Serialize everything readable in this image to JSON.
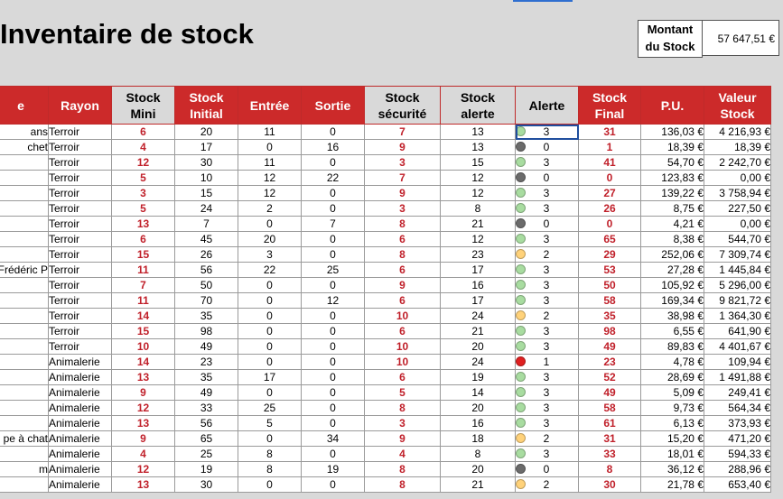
{
  "title": "Inventaire de stock",
  "summary": {
    "label_line1": "Montant",
    "label_line2": "du Stock",
    "value": "57 647,51 €"
  },
  "headers": [
    {
      "l1": "e",
      "l2": ""
    },
    {
      "l1": "Rayon",
      "l2": ""
    },
    {
      "l1": "Stock",
      "l2": "Mini"
    },
    {
      "l1": "Stock",
      "l2": "Initial"
    },
    {
      "l1": "Entrée",
      "l2": ""
    },
    {
      "l1": "Sortie",
      "l2": ""
    },
    {
      "l1": "Stock",
      "l2": "sécurité"
    },
    {
      "l1": "Stock",
      "l2": "alerte"
    },
    {
      "l1": "Alerte",
      "l2": ""
    },
    {
      "l1": "Stock",
      "l2": "Final"
    },
    {
      "l1": "P.U.",
      "l2": ""
    },
    {
      "l1": "Valeur",
      "l2": "Stock"
    }
  ],
  "alert_colors": {
    "green": "#a8dca0",
    "gray": "#6b6b6b",
    "orange": "#ffd27a",
    "red": "#e02020"
  },
  "rows": [
    {
      "name": "ans",
      "rayon": "Terroir",
      "mini": "6",
      "initial": "20",
      "entree": "11",
      "sortie": "0",
      "securite": "7",
      "alerte": "13",
      "flag": "green",
      "flag_val": "3",
      "final": "31",
      "pu": "136,03 €",
      "valeur": "4 216,93 €"
    },
    {
      "name": "chet",
      "rayon": "Terroir",
      "mini": "4",
      "initial": "17",
      "entree": "0",
      "sortie": "16",
      "securite": "9",
      "alerte": "13",
      "flag": "gray",
      "flag_val": "0",
      "final": "1",
      "pu": "18,39 €",
      "valeur": "18,39 €"
    },
    {
      "name": "",
      "rayon": "Terroir",
      "mini": "12",
      "initial": "30",
      "entree": "11",
      "sortie": "0",
      "securite": "3",
      "alerte": "15",
      "flag": "green",
      "flag_val": "3",
      "final": "41",
      "pu": "54,70 €",
      "valeur": "2 242,70 €"
    },
    {
      "name": "",
      "rayon": "Terroir",
      "mini": "5",
      "initial": "10",
      "entree": "12",
      "sortie": "22",
      "securite": "7",
      "alerte": "12",
      "flag": "gray",
      "flag_val": "0",
      "final": "0",
      "pu": "123,83 €",
      "valeur": "0,00 €"
    },
    {
      "name": "",
      "rayon": "Terroir",
      "mini": "3",
      "initial": "15",
      "entree": "12",
      "sortie": "0",
      "securite": "9",
      "alerte": "12",
      "flag": "green",
      "flag_val": "3",
      "final": "27",
      "pu": "139,22 €",
      "valeur": "3 758,94 €"
    },
    {
      "name": "",
      "rayon": "Terroir",
      "mini": "5",
      "initial": "24",
      "entree": "2",
      "sortie": "0",
      "securite": "3",
      "alerte": "8",
      "flag": "green",
      "flag_val": "3",
      "final": "26",
      "pu": "8,75 €",
      "valeur": "227,50 €"
    },
    {
      "name": "",
      "rayon": "Terroir",
      "mini": "13",
      "initial": "7",
      "entree": "0",
      "sortie": "7",
      "securite": "8",
      "alerte": "21",
      "flag": "gray",
      "flag_val": "0",
      "final": "0",
      "pu": "4,21 €",
      "valeur": "0,00 €"
    },
    {
      "name": "",
      "rayon": "Terroir",
      "mini": "6",
      "initial": "45",
      "entree": "20",
      "sortie": "0",
      "securite": "6",
      "alerte": "12",
      "flag": "green",
      "flag_val": "3",
      "final": "65",
      "pu": "8,38 €",
      "valeur": "544,70 €"
    },
    {
      "name": "",
      "rayon": "Terroir",
      "mini": "15",
      "initial": "26",
      "entree": "3",
      "sortie": "0",
      "securite": "8",
      "alerte": "23",
      "flag": "orange",
      "flag_val": "2",
      "final": "29",
      "pu": "252,06 €",
      "valeur": "7 309,74 €"
    },
    {
      "name": "Frédéric P",
      "rayon": "Terroir",
      "mini": "11",
      "initial": "56",
      "entree": "22",
      "sortie": "25",
      "securite": "6",
      "alerte": "17",
      "flag": "green",
      "flag_val": "3",
      "final": "53",
      "pu": "27,28 €",
      "valeur": "1 445,84 €"
    },
    {
      "name": "",
      "rayon": "Terroir",
      "mini": "7",
      "initial": "50",
      "entree": "0",
      "sortie": "0",
      "securite": "9",
      "alerte": "16",
      "flag": "green",
      "flag_val": "3",
      "final": "50",
      "pu": "105,92 €",
      "valeur": "5 296,00 €"
    },
    {
      "name": "",
      "rayon": "Terroir",
      "mini": "11",
      "initial": "70",
      "entree": "0",
      "sortie": "12",
      "securite": "6",
      "alerte": "17",
      "flag": "green",
      "flag_val": "3",
      "final": "58",
      "pu": "169,34 €",
      "valeur": "9 821,72 €"
    },
    {
      "name": "",
      "rayon": "Terroir",
      "mini": "14",
      "initial": "35",
      "entree": "0",
      "sortie": "0",
      "securite": "10",
      "alerte": "24",
      "flag": "orange",
      "flag_val": "2",
      "final": "35",
      "pu": "38,98 €",
      "valeur": "1 364,30 €"
    },
    {
      "name": "",
      "rayon": "Terroir",
      "mini": "15",
      "initial": "98",
      "entree": "0",
      "sortie": "0",
      "securite": "6",
      "alerte": "21",
      "flag": "green",
      "flag_val": "3",
      "final": "98",
      "pu": "6,55 €",
      "valeur": "641,90 €"
    },
    {
      "name": "",
      "rayon": "Terroir",
      "mini": "10",
      "initial": "49",
      "entree": "0",
      "sortie": "0",
      "securite": "10",
      "alerte": "20",
      "flag": "green",
      "flag_val": "3",
      "final": "49",
      "pu": "89,83 €",
      "valeur": "4 401,67 €"
    },
    {
      "name": "",
      "rayon": "Animalerie",
      "mini": "14",
      "initial": "23",
      "entree": "0",
      "sortie": "0",
      "securite": "10",
      "alerte": "24",
      "flag": "red",
      "flag_val": "1",
      "final": "23",
      "pu": "4,78 €",
      "valeur": "109,94 €"
    },
    {
      "name": "",
      "rayon": "Animalerie",
      "mini": "13",
      "initial": "35",
      "entree": "17",
      "sortie": "0",
      "securite": "6",
      "alerte": "19",
      "flag": "green",
      "flag_val": "3",
      "final": "52",
      "pu": "28,69 €",
      "valeur": "1 491,88 €"
    },
    {
      "name": "",
      "rayon": "Animalerie",
      "mini": "9",
      "initial": "49",
      "entree": "0",
      "sortie": "0",
      "securite": "5",
      "alerte": "14",
      "flag": "green",
      "flag_val": "3",
      "final": "49",
      "pu": "5,09 €",
      "valeur": "249,41 €"
    },
    {
      "name": "",
      "rayon": "Animalerie",
      "mini": "12",
      "initial": "33",
      "entree": "25",
      "sortie": "0",
      "securite": "8",
      "alerte": "20",
      "flag": "green",
      "flag_val": "3",
      "final": "58",
      "pu": "9,73 €",
      "valeur": "564,34 €"
    },
    {
      "name": "",
      "rayon": "Animalerie",
      "mini": "13",
      "initial": "56",
      "entree": "5",
      "sortie": "0",
      "securite": "3",
      "alerte": "16",
      "flag": "green",
      "flag_val": "3",
      "final": "61",
      "pu": "6,13 €",
      "valeur": "373,93 €"
    },
    {
      "name": "pe à chat",
      "rayon": "Animalerie",
      "mini": "9",
      "initial": "65",
      "entree": "0",
      "sortie": "34",
      "securite": "9",
      "alerte": "18",
      "flag": "orange",
      "flag_val": "2",
      "final": "31",
      "pu": "15,20 €",
      "valeur": "471,20 €"
    },
    {
      "name": "",
      "rayon": "Animalerie",
      "mini": "4",
      "initial": "25",
      "entree": "8",
      "sortie": "0",
      "securite": "4",
      "alerte": "8",
      "flag": "green",
      "flag_val": "3",
      "final": "33",
      "pu": "18,01 €",
      "valeur": "594,33 €"
    },
    {
      "name": "m",
      "rayon": "Animalerie",
      "mini": "12",
      "initial": "19",
      "entree": "8",
      "sortie": "19",
      "securite": "8",
      "alerte": "20",
      "flag": "gray",
      "flag_val": "0",
      "final": "8",
      "pu": "36,12 €",
      "valeur": "288,96 €"
    },
    {
      "name": "",
      "rayon": "Animalerie",
      "mini": "13",
      "initial": "30",
      "entree": "0",
      "sortie": "0",
      "securite": "8",
      "alerte": "21",
      "flag": "orange",
      "flag_val": "2",
      "final": "30",
      "pu": "21,78 €",
      "valeur": "653,40 €"
    }
  ]
}
